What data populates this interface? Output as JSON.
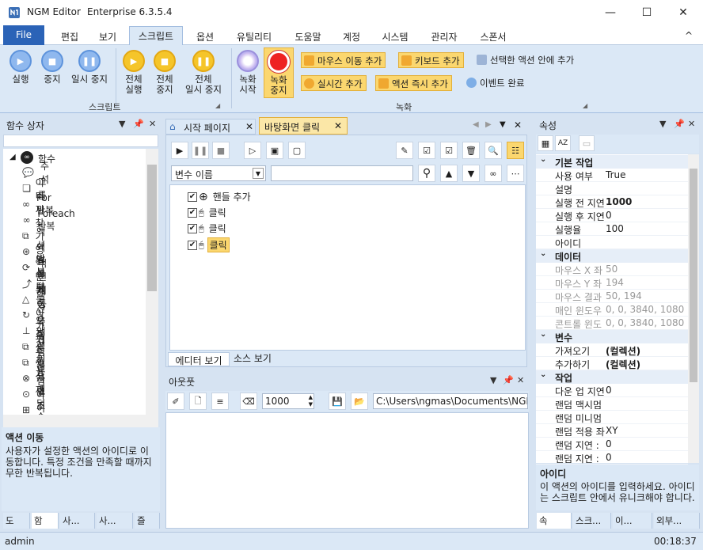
{
  "window": {
    "app": "NGM Editor",
    "edition": "Enterprise 6.3.5.4",
    "minimize": "—",
    "maximize": "☐",
    "close": "✕"
  },
  "menu": {
    "file": "File",
    "tabs": [
      "편집",
      "보기",
      "스크립트",
      "옵션",
      "유틸리티",
      "도움말",
      "계정",
      "시스템",
      "관리자",
      "스폰서"
    ],
    "collapse": "^"
  },
  "ribbon": {
    "script_group": "스크립트",
    "record_group": "녹화",
    "run": "실행",
    "stop": "중지",
    "pause": "일시 중지",
    "run_all_1": "전체",
    "run_all_2": "실행",
    "stop_all_1": "전체",
    "stop_all_2": "중지",
    "pause_all_1": "전체",
    "pause_all_2": "일시 중지",
    "rec_start_1": "녹화",
    "rec_start_2": "시작",
    "rec_stop_1": "녹화",
    "rec_stop_2": "중지",
    "add_mouse_move": "마우스 이동 추가",
    "add_keyboard": "키보드 추가",
    "add_in_selected": "선택한 액션 안에 추가",
    "add_realtime": "실시간 추가",
    "add_action_now": "액션 즉시 추가",
    "event_done": "이벤트 완료"
  },
  "left_panel": {
    "title": "함수 상자",
    "root": "함수",
    "items": [
      "주석",
      "그룹",
      "For 반복",
      "Foreach 반복",
      "이미지 찾기 영역 반복",
      "액션 반복",
      "액션 실행",
      "액션 이동",
      "액션 되돌아가기",
      "액션 복귀",
      "캐이스 액션 이동",
      "오프셋 추가",
      "오프셋 삭제",
      "랜덤 문자열 조합",
      "랜덤 아이디",
      "랜덤 숫자"
    ],
    "desc_title": "액션 이동",
    "desc_text": "사용자가 설정한 액션의 아이디로 이동합니다. 특정 조건을 만족할 때까지 무한 반복됩니다.",
    "bottom_tabs": [
      "도",
      "함",
      "사...",
      "사...",
      "즐"
    ]
  },
  "doc_tabs": {
    "start": "시작 페이지",
    "desktop_click": "바탕화면 클릭"
  },
  "editor": {
    "var_select": "변수 이름",
    "search_value": "",
    "nodes": [
      "핸들 추가",
      "클릭",
      "클릭",
      "클릭"
    ],
    "view_tabs": [
      "에디터 보기",
      "소스 보기"
    ]
  },
  "output": {
    "title": "아웃풋",
    "count": "1000",
    "path": "C:\\Users\\ngmas\\Documents\\NGM6\\"
  },
  "properties": {
    "title": "속성",
    "cat_basic": "기본 작업",
    "basic": [
      [
        "사용 여부",
        "True"
      ],
      [
        "설명",
        ""
      ],
      [
        "실행 전 지연",
        "1000"
      ],
      [
        "실행 후 지연",
        "0"
      ],
      [
        "실행율",
        "100"
      ],
      [
        "아이디",
        ""
      ]
    ],
    "cat_data": "데이터",
    "data": [
      [
        "마우스 X 좌",
        "50"
      ],
      [
        "마우스 Y 좌",
        "194"
      ],
      [
        "마우스 결과",
        "50, 194"
      ],
      [
        "매인 윈도우",
        "0, 0, 3840, 1080"
      ],
      [
        "콘트롤 윈도",
        "0, 0, 3840, 1080"
      ]
    ],
    "cat_var": "변수",
    "var": [
      [
        "가져오기",
        "(컬렉션)"
      ],
      [
        "추가하기",
        "(컬렉션)"
      ]
    ],
    "cat_work": "작업",
    "work": [
      [
        "다운 업 지연",
        "0"
      ],
      [
        "랜덤 맥시멈",
        ""
      ],
      [
        "랜덤 미니멈",
        ""
      ],
      [
        "랜덤 적용 좌",
        "XY"
      ],
      [
        "랜덤 지연 :",
        "0"
      ],
      [
        "랜덤 지연 :",
        "0"
      ]
    ],
    "desc_title": "아이디",
    "desc_text": "이 액션의 아이디를 입력하세요. 아이디는 스크립트 안에서 유니크해야 합니다.",
    "bottom_tabs": [
      "속",
      "스크...",
      "이...",
      "외부..."
    ]
  },
  "status": {
    "user": "admin",
    "time": "00:18:37"
  }
}
